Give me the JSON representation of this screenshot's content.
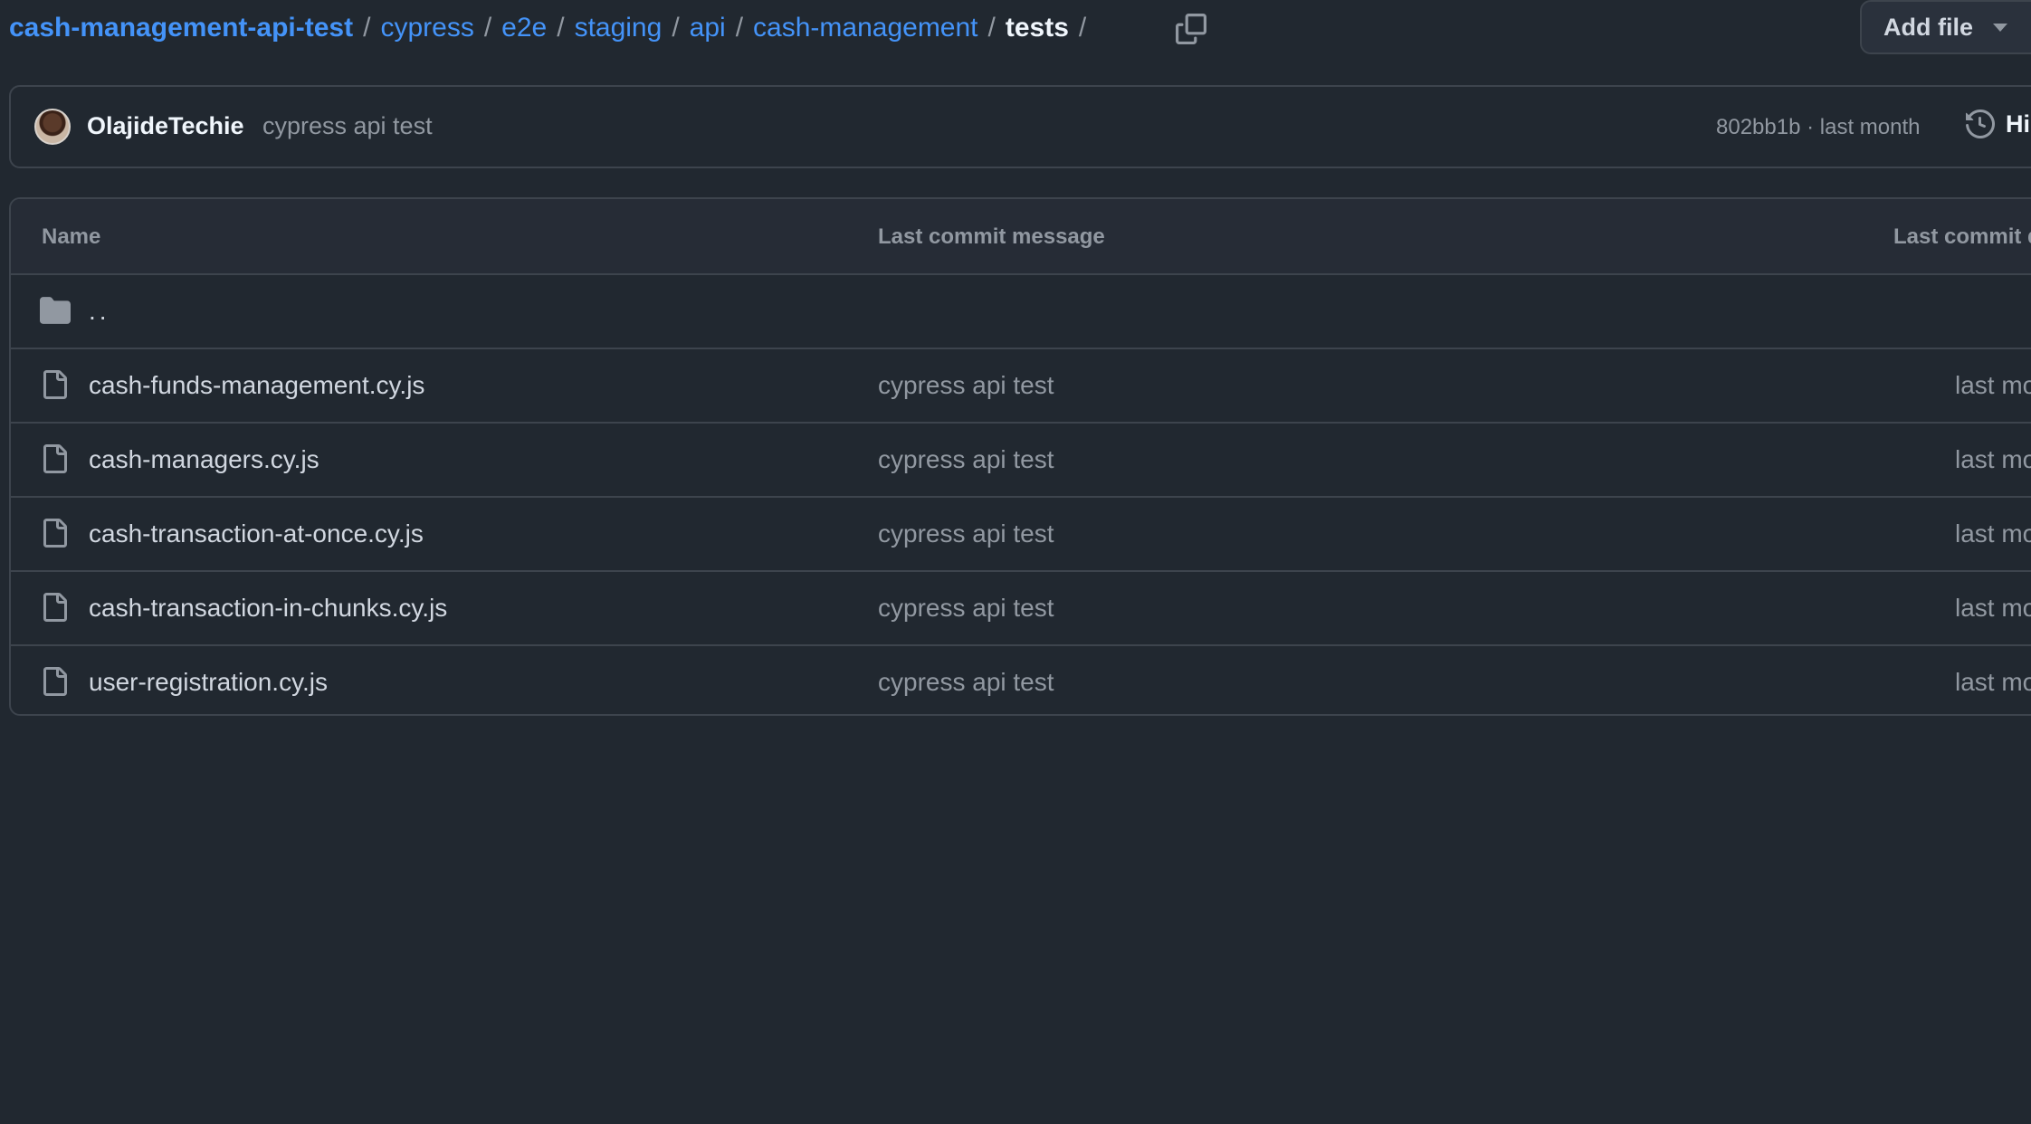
{
  "breadcrumb": {
    "repo": "cash-management-api-test",
    "segments": [
      "cypress",
      "e2e",
      "staging",
      "api",
      "cash-management"
    ],
    "current": "tests",
    "trailing_sep": "/",
    "separator": "/"
  },
  "toolbar": {
    "add_file_label": "Add file"
  },
  "commit": {
    "author": "OlajideTechie",
    "message": "cypress api test",
    "meta": "802bb1b · last month",
    "history_label": "History"
  },
  "table": {
    "headers": {
      "name": "Name",
      "message": "Last commit message",
      "date": "Last commit date"
    },
    "parent_label": "..",
    "rows": [
      {
        "name": "cash-funds-management.cy.js",
        "message": "cypress api test",
        "date": "last month"
      },
      {
        "name": "cash-managers.cy.js",
        "message": "cypress api test",
        "date": "last month"
      },
      {
        "name": "cash-transaction-at-once.cy.js",
        "message": "cypress api test",
        "date": "last month"
      },
      {
        "name": "cash-transaction-in-chunks.cy.js",
        "message": "cypress api test",
        "date": "last month"
      },
      {
        "name": "user-registration.cy.js",
        "message": "cypress api test",
        "date": "last month"
      }
    ]
  },
  "icons": {
    "copy": "copy-icon",
    "folder": "folder-icon",
    "file": "file-icon",
    "history": "history-icon",
    "caret": "triangle-down-icon"
  },
  "colors": {
    "background": "#212830",
    "link": "#4493f8",
    "muted": "#9198a1",
    "border": "#3d444d"
  }
}
